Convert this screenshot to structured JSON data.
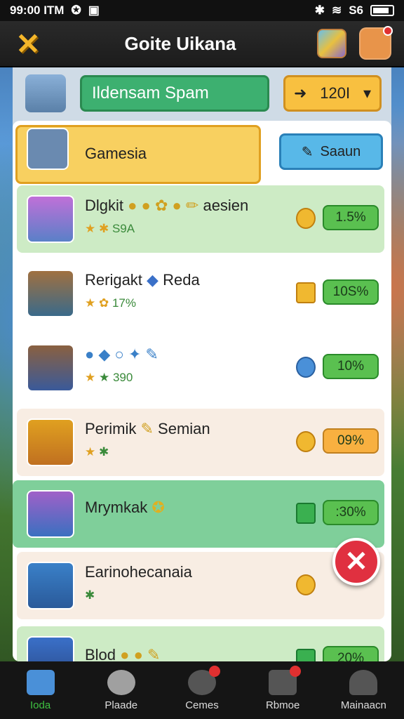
{
  "status": {
    "time": "99:00 ITM",
    "network": "S6"
  },
  "header": {
    "title": "Goite Uikana"
  },
  "controls": {
    "field_value": "Ildensam Spam",
    "select_value": "120I"
  },
  "game_row": {
    "name": "Gamesia",
    "button_label": "Saaun"
  },
  "rows": [
    {
      "name": "Dlgkit",
      "extra": "aesien",
      "sub": "S9A",
      "pct": "1.5%",
      "color": "#cdebc5"
    },
    {
      "name": "Rerigakt",
      "extra": "Reda",
      "sub": "17%",
      "pct": "10S%",
      "color": "#ffffff"
    },
    {
      "name": "",
      "extra": "",
      "sub": "390",
      "pct": "10%",
      "color": "#ffffff"
    },
    {
      "name": "Perimik",
      "extra": "Semian",
      "sub": "",
      "pct": "09%",
      "color": "#f8ede3"
    },
    {
      "name": "Mrymkak",
      "extra": "",
      "sub": "",
      "pct": ":30%",
      "color": "#7fcf9a"
    },
    {
      "name": "Earinohecanaia",
      "extra": "",
      "sub": "",
      "pct": "",
      "color": "#f8ede3"
    },
    {
      "name": "Blod",
      "extra": "",
      "sub": "",
      "pct": "20%",
      "color": "#cdebc5"
    }
  ],
  "nav": [
    {
      "label": "Ioda"
    },
    {
      "label": "Plaade"
    },
    {
      "label": "Cemes"
    },
    {
      "label": "Rbmoe"
    },
    {
      "label": "Mainaacn"
    }
  ],
  "colors": {
    "accent_green": "#3db070",
    "accent_yellow": "#f8c040",
    "close_red": "#e03040"
  }
}
